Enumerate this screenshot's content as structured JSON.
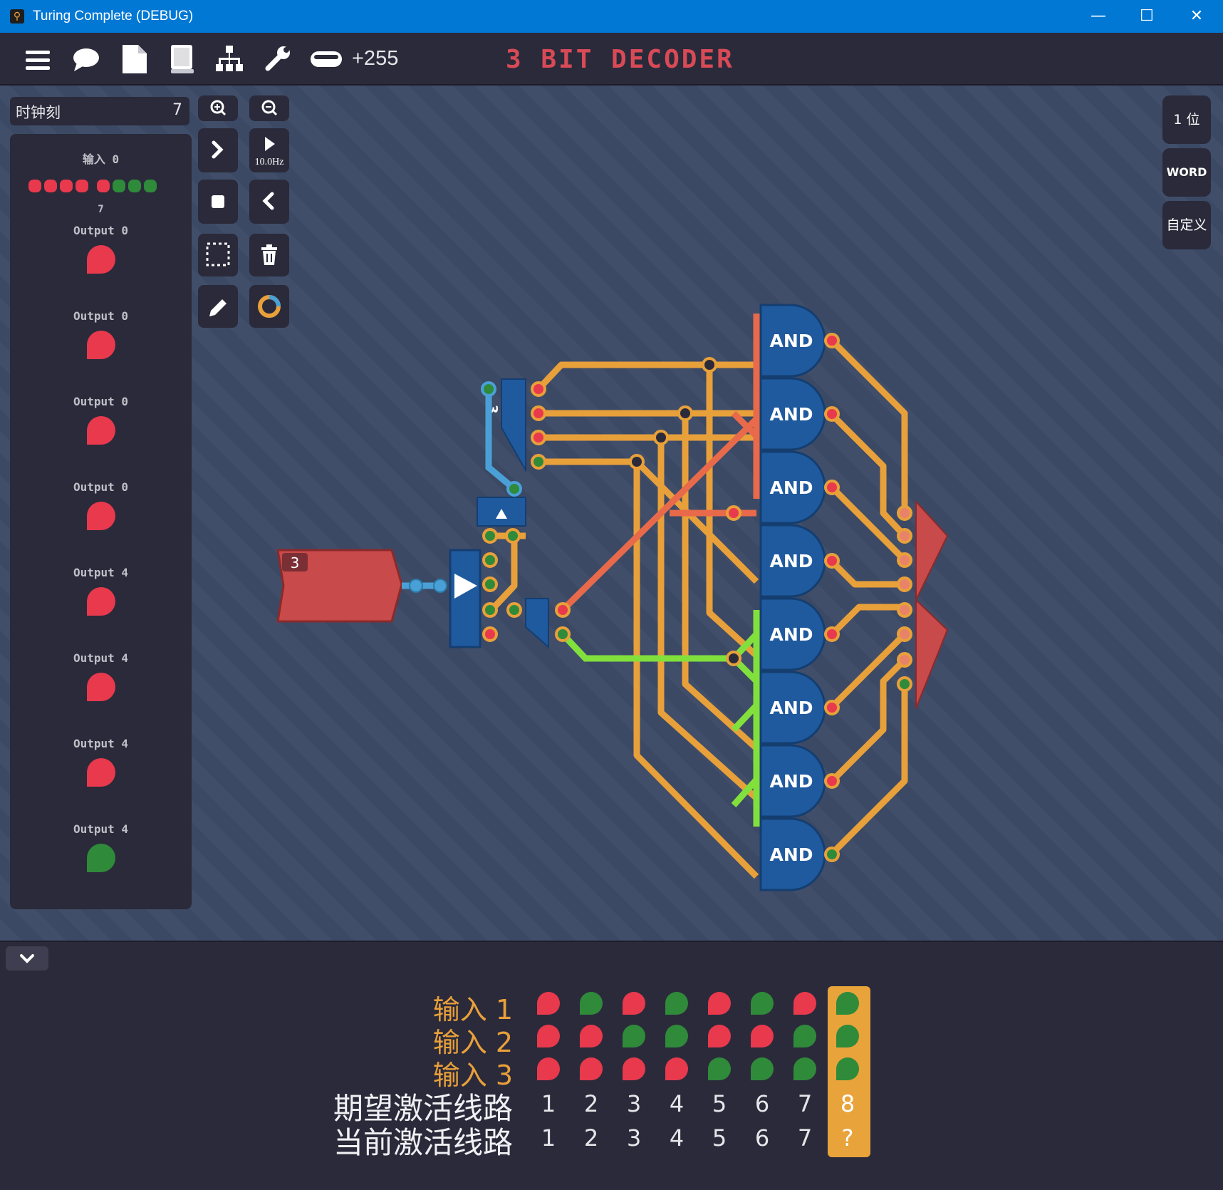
{
  "window": {
    "title": "Turing Complete (DEBUG)"
  },
  "toolbar": {
    "icons": [
      "menu-icon",
      "chat-bubble-icon",
      "document-icon",
      "book-icon",
      "hierarchy-icon",
      "wrench-icon",
      "pill-icon"
    ],
    "credit": "+255",
    "level_title": "3 BIT DECODER"
  },
  "left_panel": {
    "ticks_label": "时钟刻",
    "ticks_value": "7",
    "input_label": "输入 0",
    "input_bits": [
      "red",
      "red",
      "red",
      "red",
      "red",
      "green",
      "green",
      "green"
    ],
    "input_value": "7",
    "outputs": [
      {
        "label": "Output 0",
        "state": "red"
      },
      {
        "label": "Output 0",
        "state": "red"
      },
      {
        "label": "Output 0",
        "state": "red"
      },
      {
        "label": "Output 0",
        "state": "red"
      },
      {
        "label": "Output 4",
        "state": "red"
      },
      {
        "label": "Output 4",
        "state": "red"
      },
      {
        "label": "Output 4",
        "state": "red"
      },
      {
        "label": "Output 4",
        "state": "green"
      }
    ]
  },
  "controls": {
    "speed": "10.0Hz",
    "icons": [
      "zoom-in-icon",
      "zoom-out-icon",
      "step-forward-icon",
      "play-icon",
      "stop-icon",
      "step-back-icon",
      "select-icon",
      "trash-icon",
      "pencil-icon",
      "color-wheel-icon"
    ]
  },
  "right_buttons": {
    "bit": "1 位",
    "word": "WORD",
    "custom": "自定义"
  },
  "circuit": {
    "input_value": "3",
    "splitter_label": "3",
    "gate_label": "AND",
    "gate_count": 8
  },
  "test_table": {
    "rows": [
      {
        "label": "输入 1",
        "states": [
          "red",
          "green",
          "red",
          "green",
          "red",
          "green",
          "red",
          "green"
        ]
      },
      {
        "label": "输入 2",
        "states": [
          "red",
          "red",
          "green",
          "green",
          "red",
          "red",
          "green",
          "green"
        ]
      },
      {
        "label": "输入 3",
        "states": [
          "red",
          "red",
          "red",
          "red",
          "green",
          "green",
          "green",
          "green"
        ]
      }
    ],
    "expected_label": "期望激活线路",
    "expected": [
      "1",
      "2",
      "3",
      "4",
      "5",
      "6",
      "7",
      "8"
    ],
    "current_label": "当前激活线路",
    "current": [
      "1",
      "2",
      "3",
      "4",
      "5",
      "6",
      "7",
      "?"
    ]
  },
  "colors": {
    "titlebar": "#0078d4",
    "accent_red": "#d94a57",
    "wire_orange": "#e8a03a",
    "wire_green": "#82e03c",
    "wire_blue": "#4aa0d6",
    "gate_blue": "#1f5a9e",
    "state_red": "#e8394d",
    "state_green": "#2f8a3a"
  }
}
